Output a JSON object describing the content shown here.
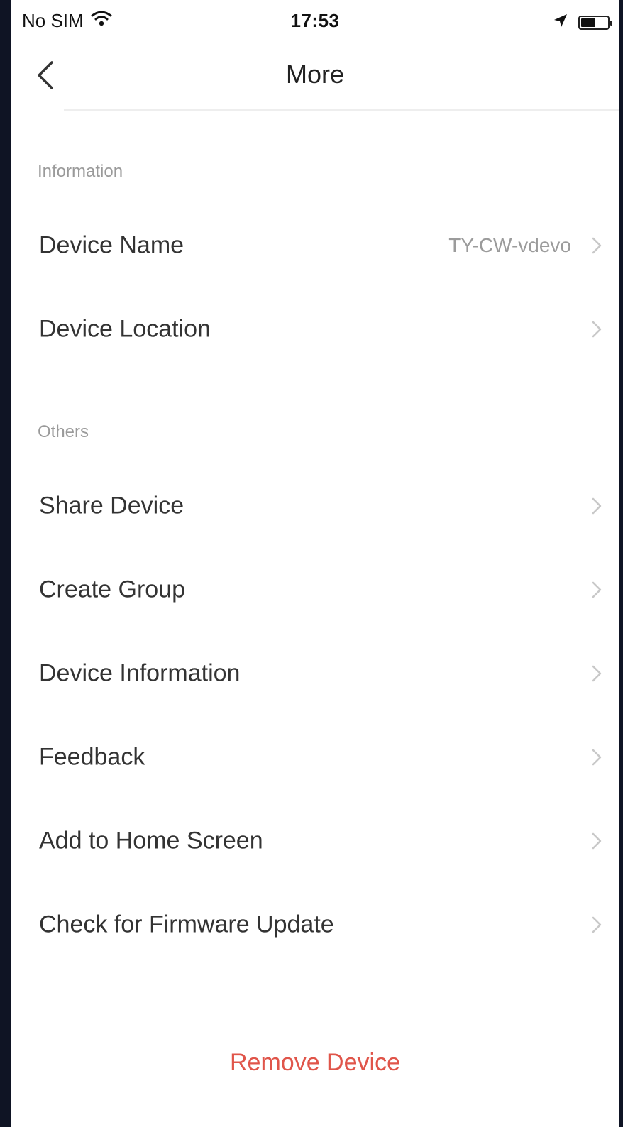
{
  "status_bar": {
    "carrier": "No SIM",
    "time": "17:53",
    "battery_level": 0.55,
    "icons": [
      "wifi-icon",
      "location-arrow-icon",
      "battery-icon"
    ]
  },
  "nav": {
    "title": "More",
    "back_icon": "chevron-left-icon"
  },
  "sections": {
    "information": {
      "header": "Information",
      "items": [
        {
          "label": "Device Name",
          "value": "TY-CW-vdevo"
        },
        {
          "label": "Device Location",
          "value": ""
        }
      ]
    },
    "others": {
      "header": "Others",
      "items": [
        {
          "label": "Share Device"
        },
        {
          "label": "Create Group"
        },
        {
          "label": "Device Information"
        },
        {
          "label": "Feedback"
        },
        {
          "label": "Add to Home Screen"
        },
        {
          "label": "Check for Firmware Update"
        }
      ]
    }
  },
  "actions": {
    "remove_label": "Remove Device"
  },
  "colors": {
    "accent_red": "#e0554a",
    "chevron": "#c8c8c8",
    "secondary_text": "#9b9b9b"
  }
}
